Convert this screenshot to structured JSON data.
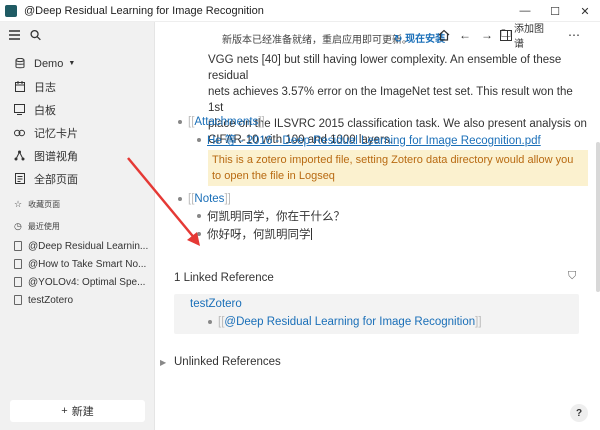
{
  "window": {
    "title": "@Deep Residual Learning for Image Recognition",
    "controls": {
      "minimize": "—",
      "maximize": "☐",
      "close": "✕"
    }
  },
  "sidebar": {
    "graph_name": "Demo",
    "nav": [
      {
        "label": "日志",
        "icon": "journal-icon"
      },
      {
        "label": "白板",
        "icon": "whiteboard-icon"
      },
      {
        "label": "记忆卡片",
        "icon": "flashcards-icon"
      },
      {
        "label": "图谱视角",
        "icon": "graph-icon"
      },
      {
        "label": "全部页面",
        "icon": "pages-icon"
      }
    ],
    "favorites_label": "收藏页面",
    "recent_label": "最近使用",
    "recent": [
      "@Deep Residual Learnin...",
      "@How to Take Smart No...",
      "@YOLOv4: Optimal Spe...",
      "testZotero"
    ],
    "new_button": "新建"
  },
  "toolbar": {
    "update_text": "新版本已经准备就绪，重启应用即可更新。",
    "install_label": "现在安装",
    "add_image_label": "添加图谱",
    "more_label": "⋯"
  },
  "content": {
    "abstract_lines": [
      "VGG nets [40] but still having lower complexity. An ensemble of these residual",
      "nets achieves 3.57% error on the ImageNet test set. This result won the 1st",
      "place on the ILSVRC 2015 classification task. We also present analysis on",
      "CIFAR-10 with 100 and 1000 layers."
    ],
    "attachments_label": "Attachments",
    "attachment_link": "He 等 - 2016 - Deep Residual Learning for Image Recognition.pdf",
    "warning_lines": [
      "This is a zotero imported file, setting Zotero data directory would allow you",
      "to open the file in Logseq"
    ],
    "notes_label": "Notes",
    "notes": [
      "何凯明同学，你在干什么？",
      "你好呀，何凯明同学"
    ]
  },
  "references": {
    "linked_title": "1 Linked Reference",
    "source_page": "testZotero",
    "ref_link": "@Deep Residual Learning for Image Recognition",
    "unlinked_title": "Unlinked References"
  },
  "help_label": "?",
  "colors": {
    "link": "#1a6fb8",
    "warning_bg": "#fbf1cf",
    "warning_text": "#b86a12",
    "arrow": "#e53935"
  }
}
